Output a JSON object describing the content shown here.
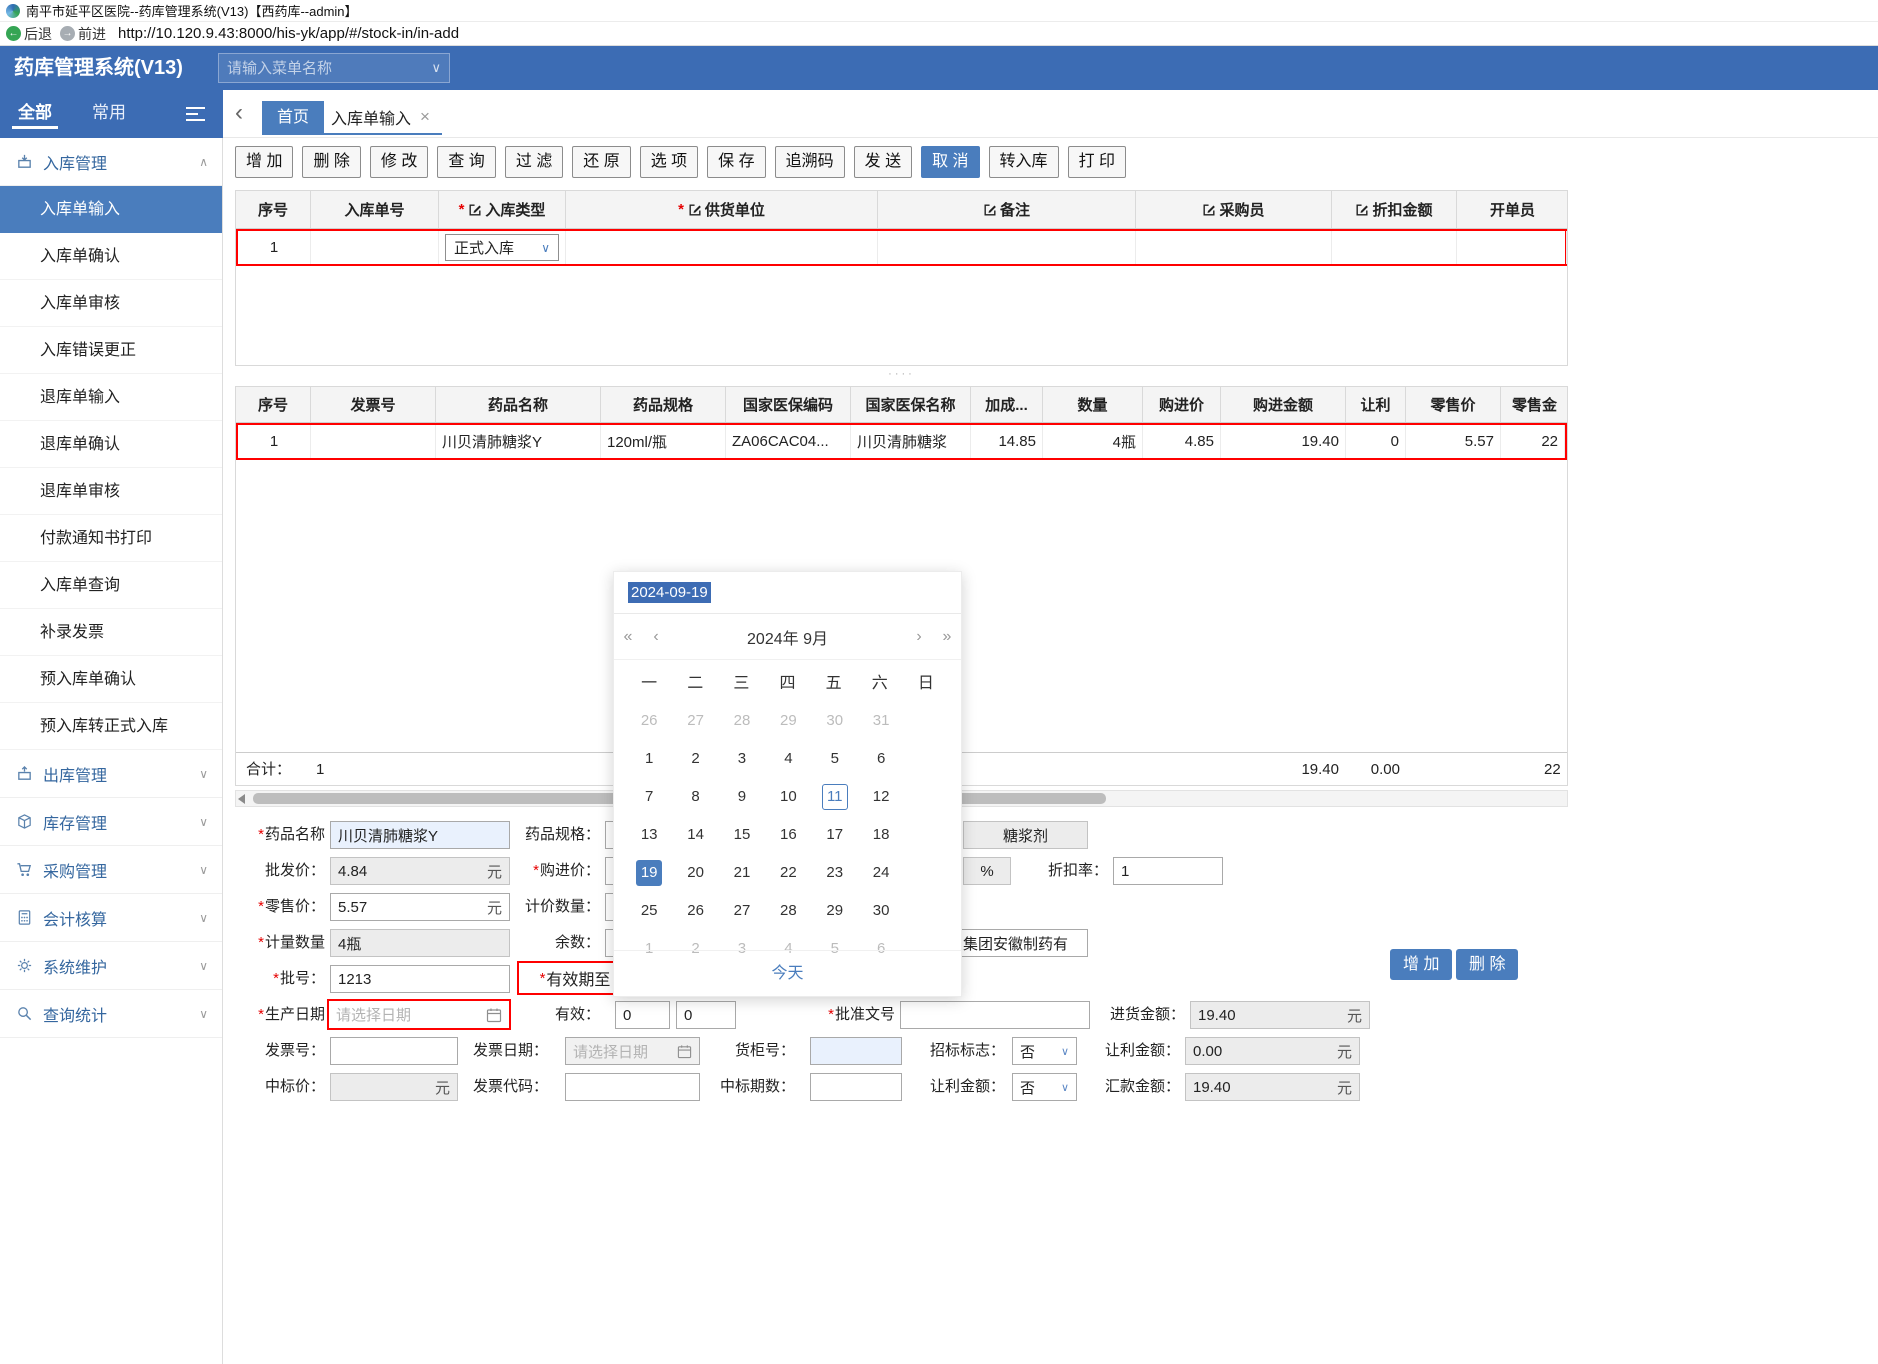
{
  "window": {
    "title": "南平市延平区医院--药库管理系统(V13)【西药库--admin】",
    "back_label": "后退",
    "forward_label": "前进",
    "url": "http://10.120.9.43:8000/his-yk/app/#/stock-in/in-add"
  },
  "app_header": {
    "title": "药库管理系统(V13)",
    "menu_search_placeholder": "请输入菜单名称"
  },
  "nav": {
    "tab_all": "全部",
    "tab_common": "常用"
  },
  "tabs": {
    "home": "首页",
    "current": "入库单输入",
    "close": "×"
  },
  "sidebar": {
    "sections": [
      {
        "label": "入库管理",
        "expanded": true
      },
      {
        "label": "出库管理",
        "expanded": false
      },
      {
        "label": "库存管理",
        "expanded": false
      },
      {
        "label": "采购管理",
        "expanded": false
      },
      {
        "label": "会计核算",
        "expanded": false
      },
      {
        "label": "系统维护",
        "expanded": false
      },
      {
        "label": "查询统计",
        "expanded": false
      }
    ],
    "stock_in_items": [
      "入库单输入",
      "入库单确认",
      "入库单审核",
      "入库错误更正",
      "退库单输入",
      "退库单确认",
      "退库单审核",
      "付款通知书打印",
      "入库单查询",
      "补录发票",
      "预入库单确认",
      "预入库转正式入库"
    ],
    "active_item": "入库单输入"
  },
  "toolbar": {
    "buttons": [
      "增 加",
      "删 除",
      "修 改",
      "查 询",
      "过 滤",
      "还 原",
      "选 项",
      "保 存",
      "追溯码",
      "发 送",
      "取 消",
      "转入库",
      "打 印"
    ],
    "active": "取 消"
  },
  "master_grid": {
    "col_seq": "序号",
    "col_order_no": "入库单号",
    "col_type": "入库类型",
    "col_supplier": "供货单位",
    "col_remark": "备注",
    "col_purchaser": "采购员",
    "col_discount": "折扣金额",
    "col_clerk": "开单员",
    "row": {
      "seq": "1",
      "type_value": "正式入库"
    }
  },
  "detail_grid": {
    "columns": [
      "序号",
      "发票号",
      "药品名称",
      "药品规格",
      "国家医保编码",
      "国家医保名称",
      "加成...",
      "数量",
      "购进价",
      "购进金额",
      "让利",
      "零售价",
      "零售金"
    ],
    "row": [
      "1",
      "",
      "川贝清肺糖浆Y",
      "120ml/瓶",
      "ZA06CAC04...",
      "川贝清肺糖浆",
      "14.85",
      "4瓶",
      "4.85",
      "19.40",
      "0",
      "5.57",
      "22"
    ],
    "total_label": "合计：",
    "total_count": "1",
    "total_purchase_amount": "19.40",
    "total_rebate": "0.00",
    "total_retail": "22"
  },
  "calendar": {
    "value": "2024-09-19",
    "year_label": "2024年",
    "month_label": "9月",
    "weekdays": [
      "一",
      "二",
      "三",
      "四",
      "五",
      "六",
      "日"
    ],
    "days": [
      {
        "d": "26",
        "muted": true
      },
      {
        "d": "27",
        "muted": true
      },
      {
        "d": "28",
        "muted": true
      },
      {
        "d": "29",
        "muted": true
      },
      {
        "d": "30",
        "muted": true
      },
      {
        "d": "31",
        "muted": true
      },
      {
        "d": "1"
      },
      {
        "d": "2"
      },
      {
        "d": "3"
      },
      {
        "d": "4"
      },
      {
        "d": "5"
      },
      {
        "d": "6"
      },
      {
        "d": "7"
      },
      {
        "d": "8"
      },
      {
        "d": "9"
      },
      {
        "d": "10"
      },
      {
        "d": "11",
        "today": true
      },
      {
        "d": "12"
      },
      {
        "d": "13"
      },
      {
        "d": "14"
      },
      {
        "d": "15"
      },
      {
        "d": "16"
      },
      {
        "d": "17"
      },
      {
        "d": "18"
      },
      {
        "d": "19",
        "selected": true
      },
      {
        "d": "20"
      },
      {
        "d": "21"
      },
      {
        "d": "22"
      },
      {
        "d": "23"
      },
      {
        "d": "24"
      },
      {
        "d": "25"
      },
      {
        "d": "26"
      },
      {
        "d": "27"
      },
      {
        "d": "28"
      },
      {
        "d": "29"
      },
      {
        "d": "30"
      },
      {
        "d": "1",
        "muted": true
      },
      {
        "d": "2",
        "muted": true
      },
      {
        "d": "3",
        "muted": true
      },
      {
        "d": "4",
        "muted": true
      },
      {
        "d": "5",
        "muted": true
      },
      {
        "d": "6",
        "muted": true
      }
    ],
    "today_label": "今天"
  },
  "form": {
    "drug_name_label": "药品名称",
    "drug_name_value": "川贝清肺糖浆Y",
    "drug_spec_label": "药品规格：",
    "dosage_form_value": "糖浆剂",
    "wholesale_label": "批发价：",
    "wholesale_value": "4.84",
    "purchase_price_label": "购进价：",
    "percent_sign": "%",
    "discount_rate_label": "折扣率：",
    "discount_rate_value": "1",
    "retail_label": "零售价：",
    "retail_value": "5.57",
    "pricing_qty_label": "计价数量：",
    "measure_qty_label": "计量数量",
    "measure_qty_value": "4瓶",
    "remainder_label": "余数：",
    "manufacturer_value": "集团安徽制药有",
    "batch_label": "批号：",
    "batch_value": "1213",
    "expiry_label": "有效期至",
    "production_date_label": "生产日期",
    "date_placeholder": "请选择日期",
    "valid_label": "有效：",
    "valid_value1": "0",
    "valid_value2": "0",
    "approval_label": "批准文号",
    "purchase_amount_label": "进货金额：",
    "purchase_amount_value": "19.40",
    "invoice_no_label": "发票号：",
    "invoice_date_label": "发票日期：",
    "shelf_label": "货柜号：",
    "bid_flag_label": "招标标志：",
    "bid_flag_value": "否",
    "rebate_amount_label": "让利金额：",
    "rebate_amount_value": "0.00",
    "bid_price_label": "中标价：",
    "invoice_code_label": "发票代码：",
    "bid_period_label": "中标期数：",
    "rebate_flag_label": "让利金额：",
    "rebate_flag_value": "否",
    "remit_label": "汇款金额：",
    "remit_value": "19.40",
    "unit_yuan": "元",
    "add_button": "增 加",
    "delete_button": "删 除"
  }
}
